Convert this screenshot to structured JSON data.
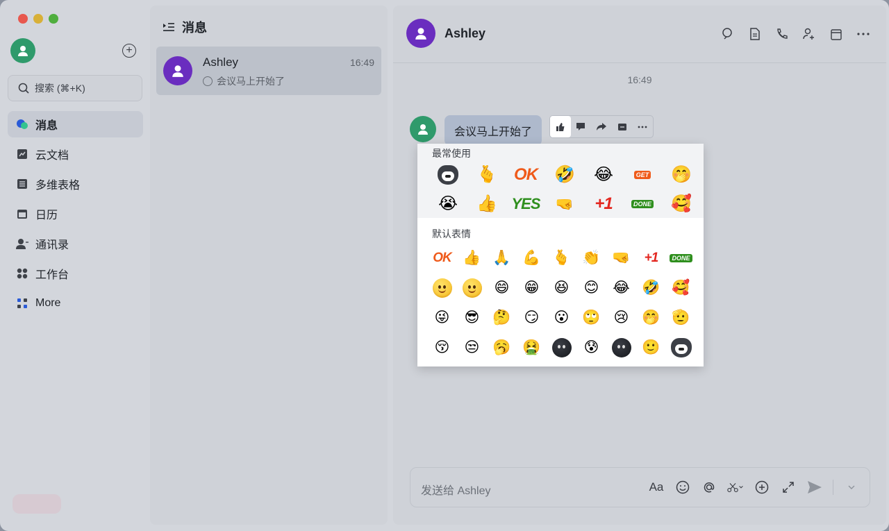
{
  "nav": {
    "search_placeholder": "搜索 (⌘+K)",
    "items": [
      {
        "label": "消息",
        "icon": "message-bubble-icon",
        "active": true
      },
      {
        "label": "云文档",
        "icon": "cloud-docs-icon",
        "active": false
      },
      {
        "label": "多维表格",
        "icon": "base-table-icon",
        "active": false
      },
      {
        "label": "日历",
        "icon": "calendar-icon",
        "active": false
      },
      {
        "label": "通讯录",
        "icon": "contacts-icon",
        "active": false
      },
      {
        "label": "工作台",
        "icon": "workplace-icon",
        "active": false
      },
      {
        "label": "More",
        "icon": "more-apps-icon",
        "active": false
      }
    ]
  },
  "list": {
    "title": "消息",
    "conversation": {
      "name": "Ashley",
      "time": "16:49",
      "preview": "会议马上开始了"
    }
  },
  "chat": {
    "title": "Ashley",
    "time_separator": "16:49",
    "message": "会议马上开始了",
    "input_placeholder": "发送给 Ashley",
    "format_label": "Aa"
  },
  "emoji_picker": {
    "frequent_title": "最常使用",
    "default_title": "默认表情",
    "frequent_texts": {
      "ok": "OK",
      "get": "GET",
      "yes": "YES",
      "plus_one": "+1",
      "done": "DONE"
    },
    "default_texts": {
      "ok": "OK",
      "plus_one": "+1",
      "done": "DONE"
    }
  },
  "colors": {
    "accent_purple": "#6a2dbf",
    "accent_green": "#2f9a6b",
    "bubble": "#aeb9cc"
  }
}
